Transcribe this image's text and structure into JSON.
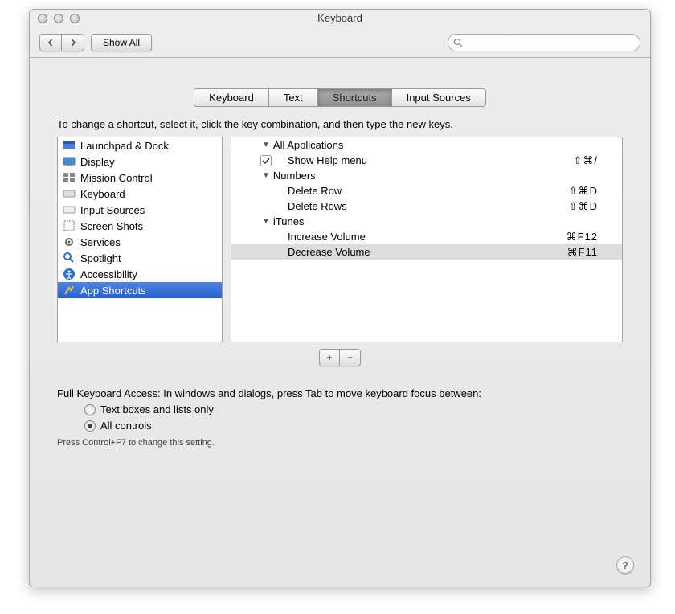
{
  "title": "Keyboard",
  "toolbar": {
    "show_all": "Show All"
  },
  "tabs": {
    "t0": "Keyboard",
    "t1": "Text",
    "t2": "Shortcuts",
    "t3": "Input Sources"
  },
  "instructions": "To change a shortcut, select it, click the key combination, and then type the new keys.",
  "categories": {
    "c0": "Launchpad & Dock",
    "c1": "Display",
    "c2": "Mission Control",
    "c3": "Keyboard",
    "c4": "Input Sources",
    "c5": "Screen Shots",
    "c6": "Services",
    "c7": "Spotlight",
    "c8": "Accessibility",
    "c9": "App Shortcuts"
  },
  "groups": {
    "g0": {
      "name": "All Applications"
    },
    "g1": {
      "name": "Numbers"
    },
    "g2": {
      "name": "iTunes"
    }
  },
  "shortcuts": {
    "s0": {
      "name": "Show Help menu",
      "keys": "⇧⌘/"
    },
    "s1": {
      "name": "Delete Row",
      "keys": "⇧⌘D"
    },
    "s2": {
      "name": "Delete Rows",
      "keys": "⇧⌘D"
    },
    "s3": {
      "name": "Increase Volume",
      "keys": "⌘F12"
    },
    "s4": {
      "name": "Decrease Volume",
      "keys": "⌘F11"
    }
  },
  "fka": {
    "label": "Full Keyboard Access: In windows and dialogs, press Tab to move keyboard focus between:",
    "opt0": "Text boxes and lists only",
    "opt1": "All controls",
    "hint": "Press Control+F7 to change this setting."
  },
  "glyphs": {
    "plus": "+",
    "minus": "−",
    "help": "?"
  }
}
